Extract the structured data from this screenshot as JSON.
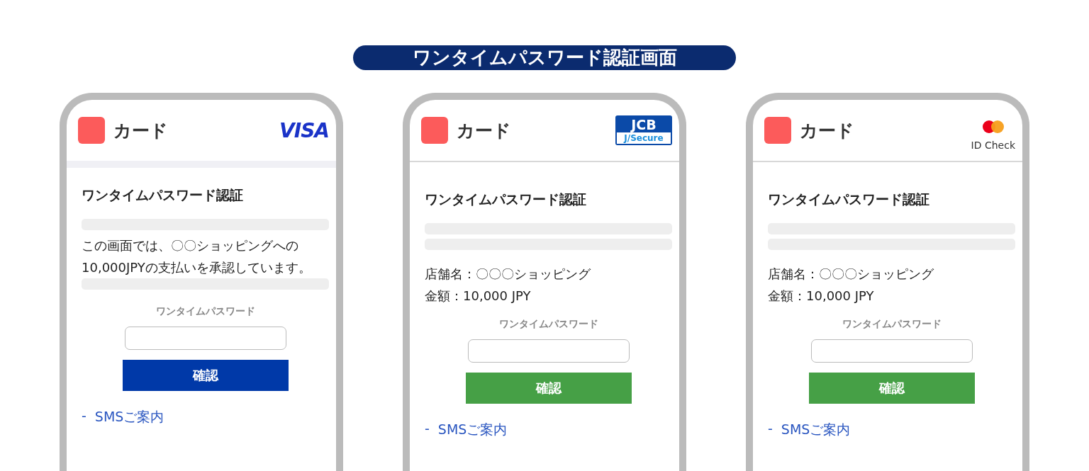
{
  "banner": "ワンタイムパスワード認証画面",
  "screens": [
    {
      "kind": "visa",
      "brand": "カード",
      "logo": [
        "VISA"
      ],
      "title": "ワンタイムパスワード認証",
      "content": [
        {
          "kind": "bar"
        },
        {
          "kind": "text",
          "text": "この画面では、〇〇ショッピングへの10,000JPYの支払いを承認しています。"
        },
        {
          "kind": "bar"
        }
      ],
      "field_label": "ワンタイムパスワード",
      "button": "確認",
      "link_prefix": "-",
      "link": "SMSご案内"
    },
    {
      "kind": "jcb",
      "brand": "カード",
      "logo": [
        "JCB",
        "J/Secure"
      ],
      "title": "ワンタイムパスワード認証",
      "content": [
        {
          "kind": "bar"
        },
        {
          "kind": "bar"
        },
        {
          "kind": "text",
          "text": "店舗名：〇〇〇ショッピング"
        },
        {
          "kind": "text",
          "text": "金額：10,000 JPY"
        }
      ],
      "field_label": "ワンタイムパスワード",
      "button": "確認",
      "link_prefix": "-",
      "link": "SMSご案内"
    },
    {
      "kind": "mastercard",
      "brand": "カード",
      "logo": [
        "ID Check"
      ],
      "title": "ワンタイムパスワード認証",
      "content": [
        {
          "kind": "bar"
        },
        {
          "kind": "bar"
        },
        {
          "kind": "text",
          "text": "店舗名：〇〇〇ショッピング"
        },
        {
          "kind": "text",
          "text": "金額：10,000 JPY"
        }
      ],
      "field_label": "ワンタイムパスワード",
      "button": "確認",
      "link_prefix": "-",
      "link": "SMSご案内"
    }
  ]
}
